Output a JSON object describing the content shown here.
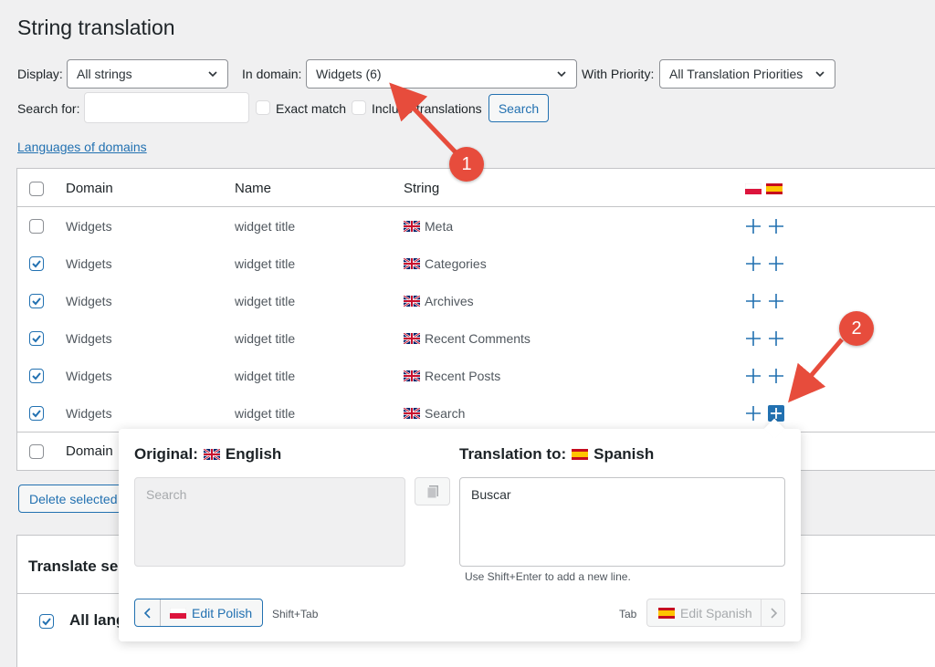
{
  "page": {
    "title": "String translation"
  },
  "filters": {
    "display_label": "Display:",
    "display_value": "All strings",
    "domain_label": "In domain:",
    "domain_value": "Widgets (6)",
    "priority_label": "With Priority:",
    "priority_value": "All Translation Priorities",
    "search_label": "Search for:",
    "search_value": "",
    "exact_match_label": "Exact match",
    "include_translations_label": "Include translations",
    "search_button": "Search",
    "languages_link": "Languages of domains"
  },
  "table": {
    "headers": {
      "domain": "Domain",
      "name": "Name",
      "string": "String"
    },
    "rows": [
      {
        "domain": "Widgets",
        "name": "widget title",
        "string": "Meta",
        "checked": false
      },
      {
        "domain": "Widgets",
        "name": "widget title",
        "string": "Categories",
        "checked": true
      },
      {
        "domain": "Widgets",
        "name": "widget title",
        "string": "Archives",
        "checked": true
      },
      {
        "domain": "Widgets",
        "name": "widget title",
        "string": "Recent Comments",
        "checked": true
      },
      {
        "domain": "Widgets",
        "name": "widget title",
        "string": "Recent Posts",
        "checked": true
      },
      {
        "domain": "Widgets",
        "name": "widget title",
        "string": "Search",
        "checked": true
      }
    ],
    "footer_domain": "Domain"
  },
  "bulk": {
    "delete_selected": "Delete selected"
  },
  "translate_section": {
    "title": "Translate se",
    "all_languages": "All lang"
  },
  "popup": {
    "original_label": "Original:",
    "original_lang": "English",
    "original_text": "Search",
    "translation_label": "Translation to:",
    "translation_lang": "Spanish",
    "translation_text": "Buscar",
    "hint": "Use Shift+Enter to add a new line.",
    "prev_button": "Edit Polish",
    "prev_shortcut": "Shift+Tab",
    "next_shortcut": "Tab",
    "next_button": "Edit Spanish"
  },
  "annotations": {
    "badge1": "1",
    "badge2": "2"
  },
  "colors": {
    "accent": "#2271b1",
    "badge": "#e74c3c"
  }
}
